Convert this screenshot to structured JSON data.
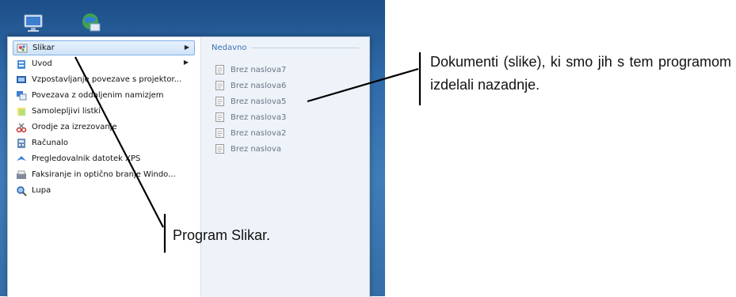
{
  "start_menu": {
    "programs": [
      {
        "label": "Slikar",
        "icon": "paint-icon",
        "has_submenu": true,
        "selected": true
      },
      {
        "label": "Uvod",
        "icon": "getting-started-icon",
        "has_submenu": true,
        "selected": false
      },
      {
        "label": "Vzpostavljanje povezave s projektor...",
        "icon": "projector-icon",
        "has_submenu": false,
        "selected": false
      },
      {
        "label": "Povezava z oddaljenim namizjem",
        "icon": "remote-desktop-icon",
        "has_submenu": false,
        "selected": false
      },
      {
        "label": "Samolepljivi listki",
        "icon": "sticky-notes-icon",
        "has_submenu": false,
        "selected": false
      },
      {
        "label": "Orodje za izrezovanje",
        "icon": "snipping-tool-icon",
        "has_submenu": false,
        "selected": false
      },
      {
        "label": "Računalo",
        "icon": "calculator-icon",
        "has_submenu": false,
        "selected": false
      },
      {
        "label": "Pregledovalnik datotek XPS",
        "icon": "xps-viewer-icon",
        "has_submenu": false,
        "selected": false
      },
      {
        "label": "Faksiranje in optično branje Windo...",
        "icon": "fax-scan-icon",
        "has_submenu": false,
        "selected": false
      },
      {
        "label": "Lupa",
        "icon": "magnifier-icon",
        "has_submenu": false,
        "selected": false
      }
    ],
    "recent": {
      "heading": "Nedavno",
      "items": [
        "Brez naslova7",
        "Brez naslova6",
        "Brez naslova5",
        "Brez naslova3",
        "Brez naslova2",
        "Brez naslova"
      ]
    }
  },
  "annotations": {
    "right": "Dokumenti (slike), ki smo jih s tem programom izdelali nazadnje.",
    "left": "Program Slikar."
  },
  "colors": {
    "desktop": "#2f6aa8",
    "selection_border": "#7fb0e6",
    "recent_heading": "#3a6fb0",
    "recent_text": "#6b7584"
  }
}
